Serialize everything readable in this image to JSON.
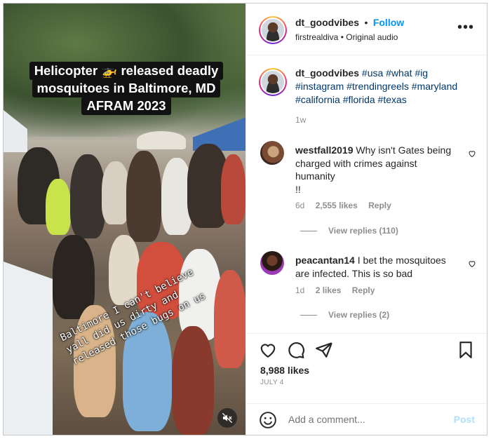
{
  "post": {
    "author": "dt_goodvibes",
    "follow_label": "Follow",
    "bullet": "•",
    "audio_owner": "firstrealdiva",
    "audio_label": "Original audio",
    "more_icon": "more-horizontal-icon"
  },
  "media": {
    "headline_lines": [
      "Helicopter 🚁 released deadly",
      "mosquitoes in Baltimore, MD",
      "AFRAM 2023"
    ],
    "sticker_lines": [
      "Baltimore I can't believe",
      "yall did us dirty and",
      "released those bugs on us"
    ],
    "mute_icon": "speaker-muted-icon"
  },
  "caption": {
    "username": "dt_goodvibes",
    "hashtags": [
      "#usa",
      "#what",
      "#ig",
      "#instagram",
      "#trendingreels",
      "#maryland",
      "#california",
      "#florida",
      "#texas"
    ],
    "time": "1w"
  },
  "comments": [
    {
      "username": "westfall2019",
      "lines": [
        "Why isn't Gates being",
        "charged with crimes against",
        "humanity",
        "!!"
      ],
      "time": "6d",
      "likes": "2,555 likes",
      "reply_label": "Reply",
      "view_replies": "View replies (110)"
    },
    {
      "username": "peacantan14",
      "lines": [
        "I bet the mosquitoes",
        "are infected. This is so bad"
      ],
      "time": "1d",
      "likes": "2 likes",
      "reply_label": "Reply",
      "view_replies": "View replies (2)"
    }
  ],
  "actions": {
    "likes": "8,988 likes",
    "date": "JULY 4",
    "icons": [
      "heart-icon",
      "comment-icon",
      "share-icon",
      "bookmark-icon"
    ]
  },
  "add_comment": {
    "placeholder": "Add a comment...",
    "post_label": "Post",
    "emoji_icon": "emoji-icon"
  },
  "colors": {
    "link_blue": "#0095f6",
    "hashtag_navy": "#00376b",
    "muted_gray": "#8e8e8e",
    "post_disabled": "#b2dffc"
  }
}
